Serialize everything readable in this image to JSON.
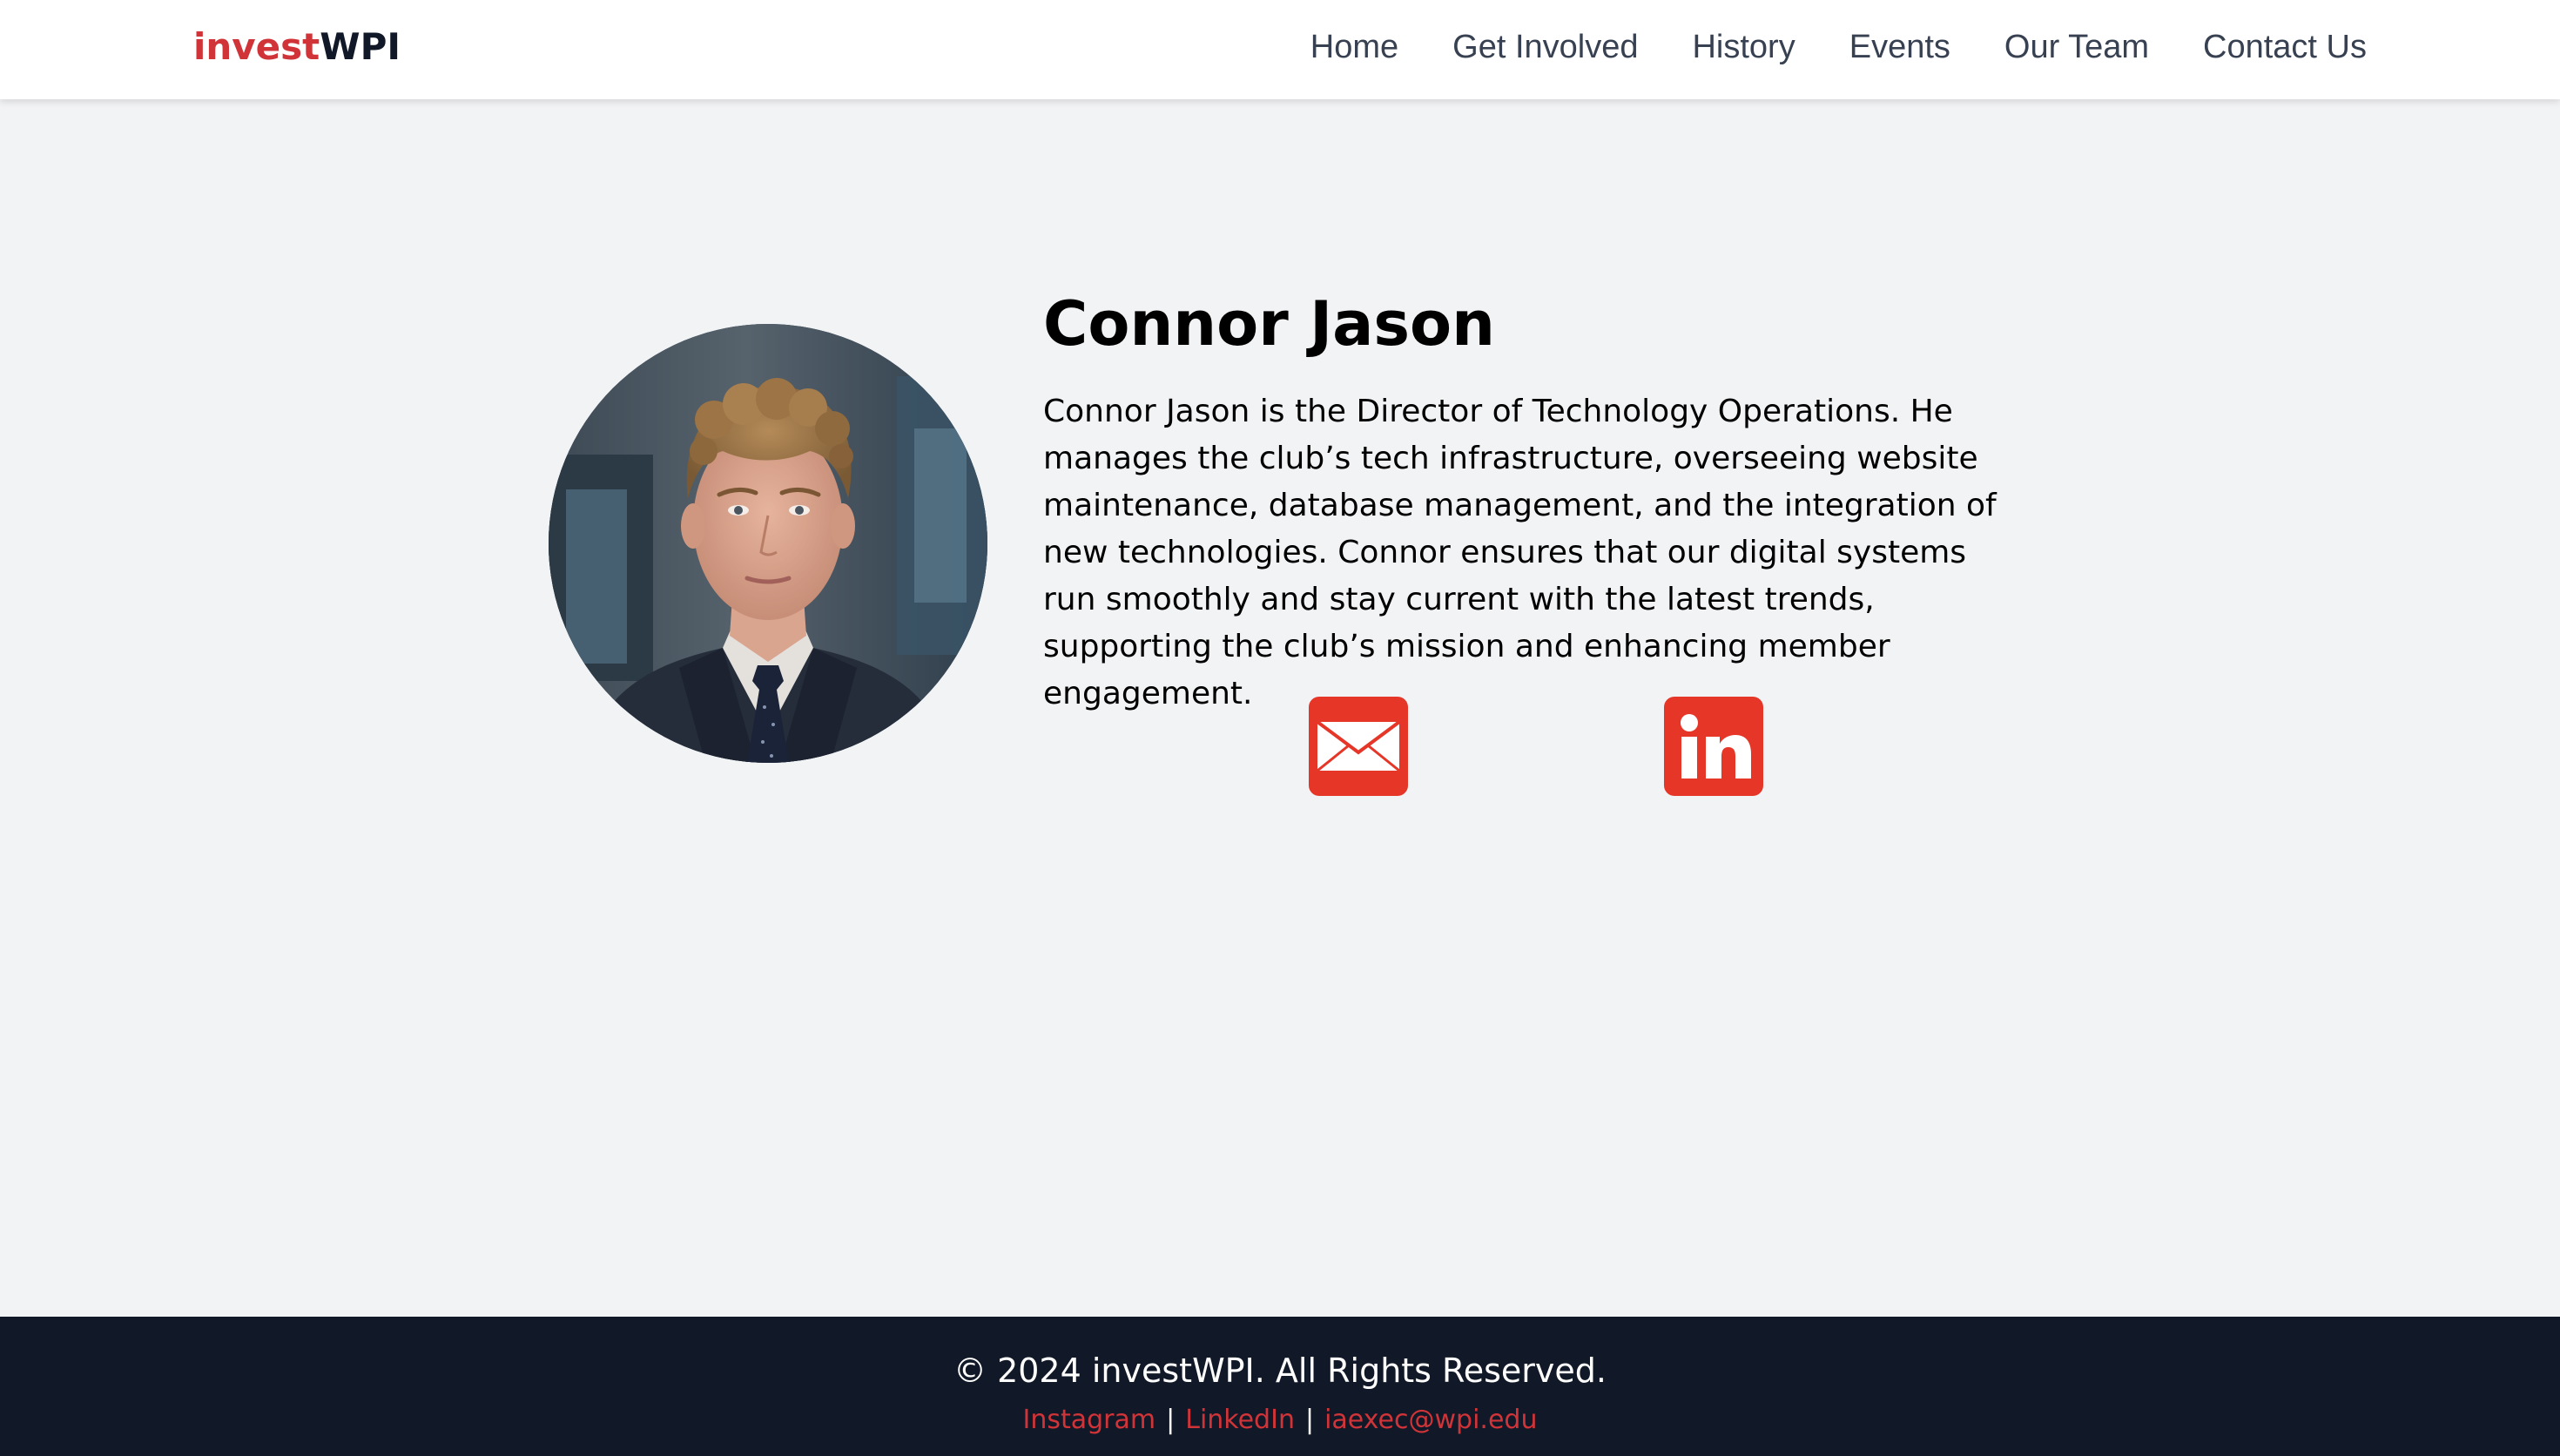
{
  "header": {
    "logo_part1": "invest",
    "logo_part2": "WPI",
    "nav": {
      "home": "Home",
      "get_involved": "Get Involved",
      "history": "History",
      "events": "Events",
      "our_team": "Our Team",
      "contact_us": "Contact Us"
    }
  },
  "profile": {
    "name": "Connor Jason",
    "bio": "Connor Jason is the Director of Technology Operations. He manages the club’s tech infrastructure, overseeing website maintenance, database management, and the integration of new technologies. Connor ensures that our digital systems run smoothly and stay current with the latest trends, supporting the club’s mission and enhancing member engagement.",
    "photo_icon": "portrait-photo",
    "social": {
      "email_icon": "envelope-icon",
      "linkedin_icon": "linkedin-icon"
    }
  },
  "footer": {
    "copyright": "© 2024 investWPI. All Rights Reserved.",
    "links": {
      "instagram": "Instagram",
      "linkedin": "LinkedIn",
      "email": "iaexec@wpi.edu",
      "separator": "|"
    }
  },
  "colors": {
    "brand_red": "#d13438",
    "icon_red": "#e53628",
    "dark_navy": "#111827",
    "page_bg": "#f2f3f5",
    "nav_text": "#374151"
  }
}
